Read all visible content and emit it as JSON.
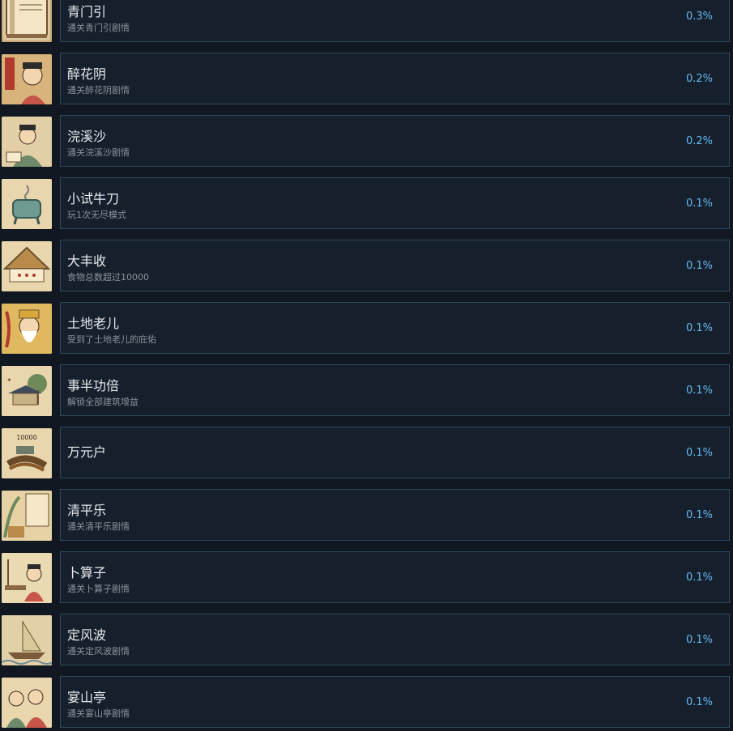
{
  "achievements": [
    {
      "title": "青门引",
      "desc": "通关青门引剧情",
      "percent": "0.3%",
      "icon": "book-icon"
    },
    {
      "title": "醉花阴",
      "desc": "通关醉花阴剧情",
      "percent": "0.2%",
      "icon": "drunk-man-icon"
    },
    {
      "title": "浣溪沙",
      "desc": "通关浣溪沙剧情",
      "percent": "0.2%",
      "icon": "reading-scholar-icon"
    },
    {
      "title": "小试牛刀",
      "desc": "玩1次无尽模式",
      "percent": "0.1%",
      "icon": "incense-burner-icon"
    },
    {
      "title": "大丰收",
      "desc": "食物总数超过10000",
      "percent": "0.1%",
      "icon": "granary-icon"
    },
    {
      "title": "土地老儿",
      "desc": "受到了土地老儿的庇佑",
      "percent": "0.1%",
      "icon": "earth-god-icon"
    },
    {
      "title": "事半功倍",
      "desc": "解锁全部建筑增益",
      "percent": "0.1%",
      "icon": "pavilion-tree-icon"
    },
    {
      "title": "万元户",
      "desc": "",
      "percent": "0.1%",
      "icon": "coin-string-icon",
      "icon_text": "10000"
    },
    {
      "title": "清平乐",
      "desc": "通关清平乐剧情",
      "percent": "0.1%",
      "icon": "garden-scene-icon"
    },
    {
      "title": "卜算子",
      "desc": "通关卜算子剧情",
      "percent": "0.1%",
      "icon": "fortune-teller-icon"
    },
    {
      "title": "定风波",
      "desc": "通关定风波剧情",
      "percent": "0.1%",
      "icon": "sailing-boat-icon"
    },
    {
      "title": "宴山亭",
      "desc": "通关宴山亭剧情",
      "percent": "0.1%",
      "icon": "banquet-people-icon"
    }
  ],
  "colors": {
    "background": "#111821",
    "card": "#16202d",
    "card_border": "#2e4a5e",
    "title": "#e8eaed",
    "description": "#8b929a",
    "percent": "#66b7ee",
    "icon_paper": "#e9d6ad"
  }
}
